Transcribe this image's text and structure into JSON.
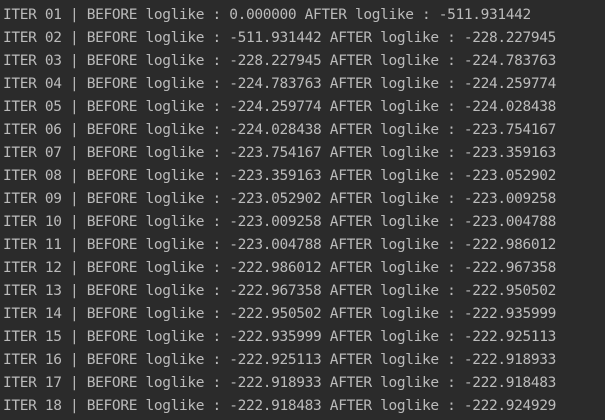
{
  "console": {
    "lines": [
      "ITER 01 | BEFORE loglike : 0.000000 AFTER loglike : -511.931442",
      "ITER 02 | BEFORE loglike : -511.931442 AFTER loglike : -228.227945",
      "ITER 03 | BEFORE loglike : -228.227945 AFTER loglike : -224.783763",
      "ITER 04 | BEFORE loglike : -224.783763 AFTER loglike : -224.259774",
      "ITER 05 | BEFORE loglike : -224.259774 AFTER loglike : -224.028438",
      "ITER 06 | BEFORE loglike : -224.028438 AFTER loglike : -223.754167",
      "ITER 07 | BEFORE loglike : -223.754167 AFTER loglike : -223.359163",
      "ITER 08 | BEFORE loglike : -223.359163 AFTER loglike : -223.052902",
      "ITER 09 | BEFORE loglike : -223.052902 AFTER loglike : -223.009258",
      "ITER 10 | BEFORE loglike : -223.009258 AFTER loglike : -223.004788",
      "ITER 11 | BEFORE loglike : -223.004788 AFTER loglike : -222.986012",
      "ITER 12 | BEFORE loglike : -222.986012 AFTER loglike : -222.967358",
      "ITER 13 | BEFORE loglike : -222.967358 AFTER loglike : -222.950502",
      "ITER 14 | BEFORE loglike : -222.950502 AFTER loglike : -222.935999",
      "ITER 15 | BEFORE loglike : -222.935999 AFTER loglike : -222.925113",
      "ITER 16 | BEFORE loglike : -222.925113 AFTER loglike : -222.918933",
      "ITER 17 | BEFORE loglike : -222.918933 AFTER loglike : -222.918483",
      "ITER 18 | BEFORE loglike : -222.918483 AFTER loglike : -222.924929"
    ]
  },
  "colors": {
    "background": "#2b2b2b",
    "text": "#bbbbbb"
  }
}
